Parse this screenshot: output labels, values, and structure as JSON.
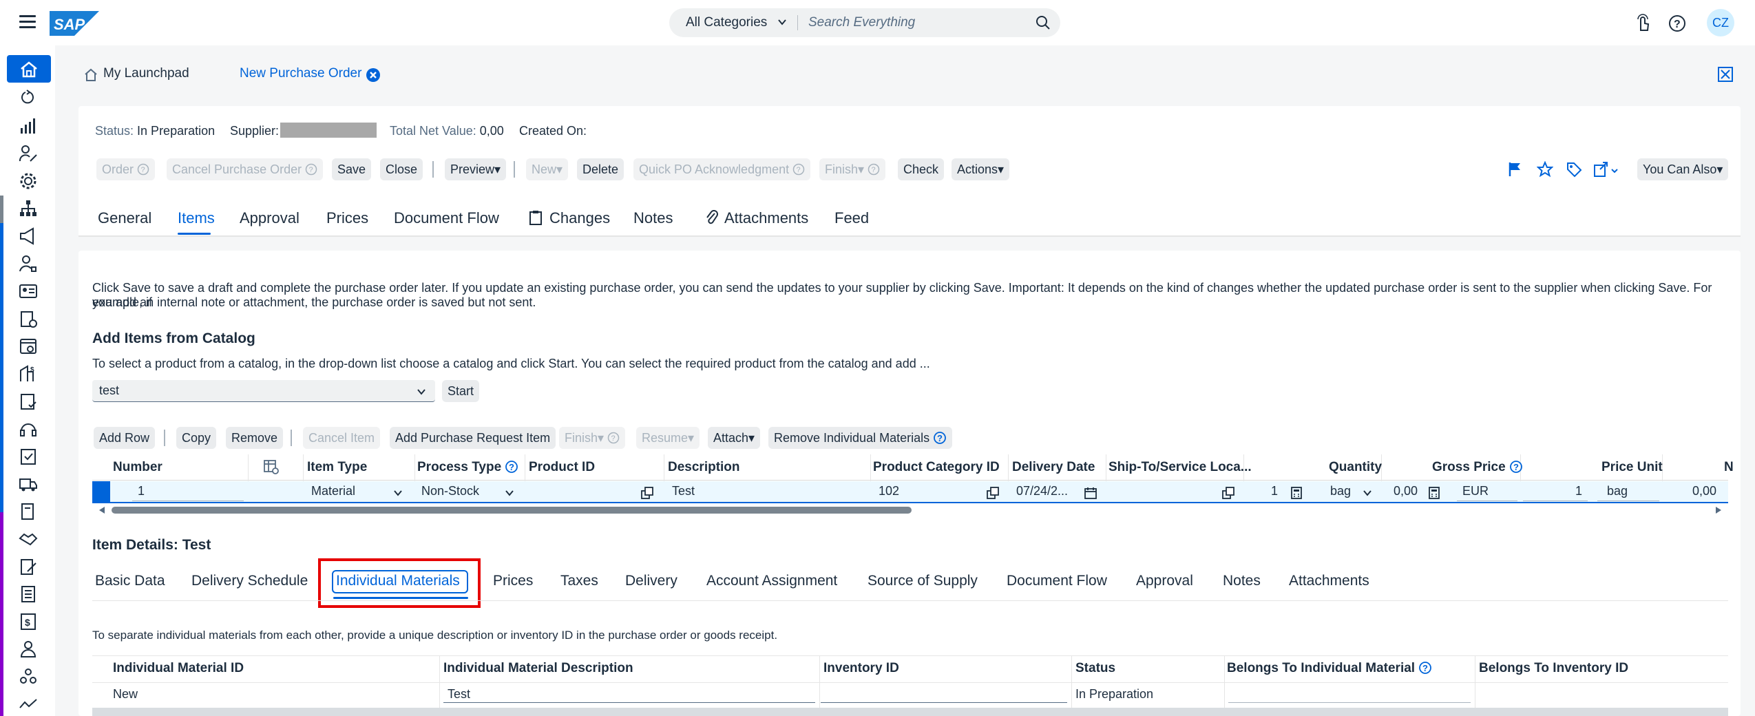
{
  "shell": {
    "logo": "SAP",
    "search_category": "All Categories",
    "search_placeholder": "Search Everything",
    "avatar_initials": "CZ"
  },
  "app_tabs": {
    "launchpad": "My Launchpad",
    "active": "New Purchase Order"
  },
  "header": {
    "status_label": "Status:",
    "status_value": "In Preparation",
    "supplier_label": "Supplier:",
    "net_label": "Total Net Value:",
    "net_value": "0,00",
    "created_label": "Created On:"
  },
  "toolbar": {
    "order": "Order",
    "cancel_po": "Cancel Purchase Order",
    "save": "Save",
    "close": "Close",
    "preview": "Preview",
    "new": "New",
    "delete": "Delete",
    "quick_ack": "Quick PO Acknowledgment",
    "finish": "Finish",
    "check": "Check",
    "actions": "Actions",
    "you_can_also": "You Can Also"
  },
  "object_tabs": [
    "General",
    "Items",
    "Approval",
    "Prices",
    "Document Flow",
    "Changes",
    "Notes",
    "Attachments",
    "Feed"
  ],
  "info_text_1": "Click Save to save a draft and complete the purchase order later. If you update an existing purchase order, you can send the updates to your supplier by clicking Save. Important: It depends on the kind of changes whether the updated purchase order is sent to the supplier when clicking Save. For example, if",
  "info_text_2": "you add an internal note or attachment, the purchase order is saved but not sent.",
  "catalog": {
    "title": "Add Items from Catalog",
    "hint": "To select a product from a catalog, in the drop-down list choose a catalog and click Start. You can select the required product from the catalog and add ...",
    "selected": "test",
    "start": "Start"
  },
  "items_toolbar": {
    "add_row": "Add Row",
    "copy": "Copy",
    "remove": "Remove",
    "cancel_item": "Cancel Item",
    "add_pr": "Add Purchase Request Item",
    "finish": "Finish",
    "resume": "Resume",
    "attach": "Attach",
    "remove_individual": "Remove Individual Materials"
  },
  "items_table": {
    "headers": [
      "Number",
      "Item Type",
      "Process Type",
      "Product ID",
      "Description",
      "Product Category ID",
      "Delivery Date",
      "Ship-To/Service Loca...",
      "Quantity",
      "Gross Price",
      "Price Unit",
      "N"
    ],
    "row": {
      "number": "1",
      "item_type": "Material",
      "process_type": "Non-Stock",
      "product_id": "",
      "description": "Test",
      "category_id": "102",
      "delivery_date": "07/24/2...",
      "ship_to": "",
      "quantity": "1",
      "unit": "bag",
      "gross_price": "0,00",
      "currency": "EUR",
      "price_unit": "1",
      "price_unit_uom": "bag",
      "net": "0,00"
    }
  },
  "item_details": {
    "title": "Item Details: Test",
    "tabs": [
      "Basic Data",
      "Delivery Schedule",
      "Individual Materials",
      "Prices",
      "Taxes",
      "Delivery",
      "Account Assignment",
      "Source of Supply",
      "Document Flow",
      "Approval",
      "Notes",
      "Attachments"
    ],
    "hint": "To separate individual materials from each other, provide a unique description or inventory ID in the purchase order or goods receipt.",
    "headers": [
      "Individual Material ID",
      "Individual Material Description",
      "Inventory ID",
      "Status",
      "Belongs To Individual Material",
      "Belongs To Inventory ID"
    ],
    "row": {
      "id": "New",
      "description": "Test",
      "inventory_id": "",
      "status": "In Preparation"
    }
  },
  "colors": {
    "accent": "#0064d9",
    "highlight": "#e60000",
    "shell_bg": "#ffffff",
    "page_bg": "#f5f6f7"
  }
}
